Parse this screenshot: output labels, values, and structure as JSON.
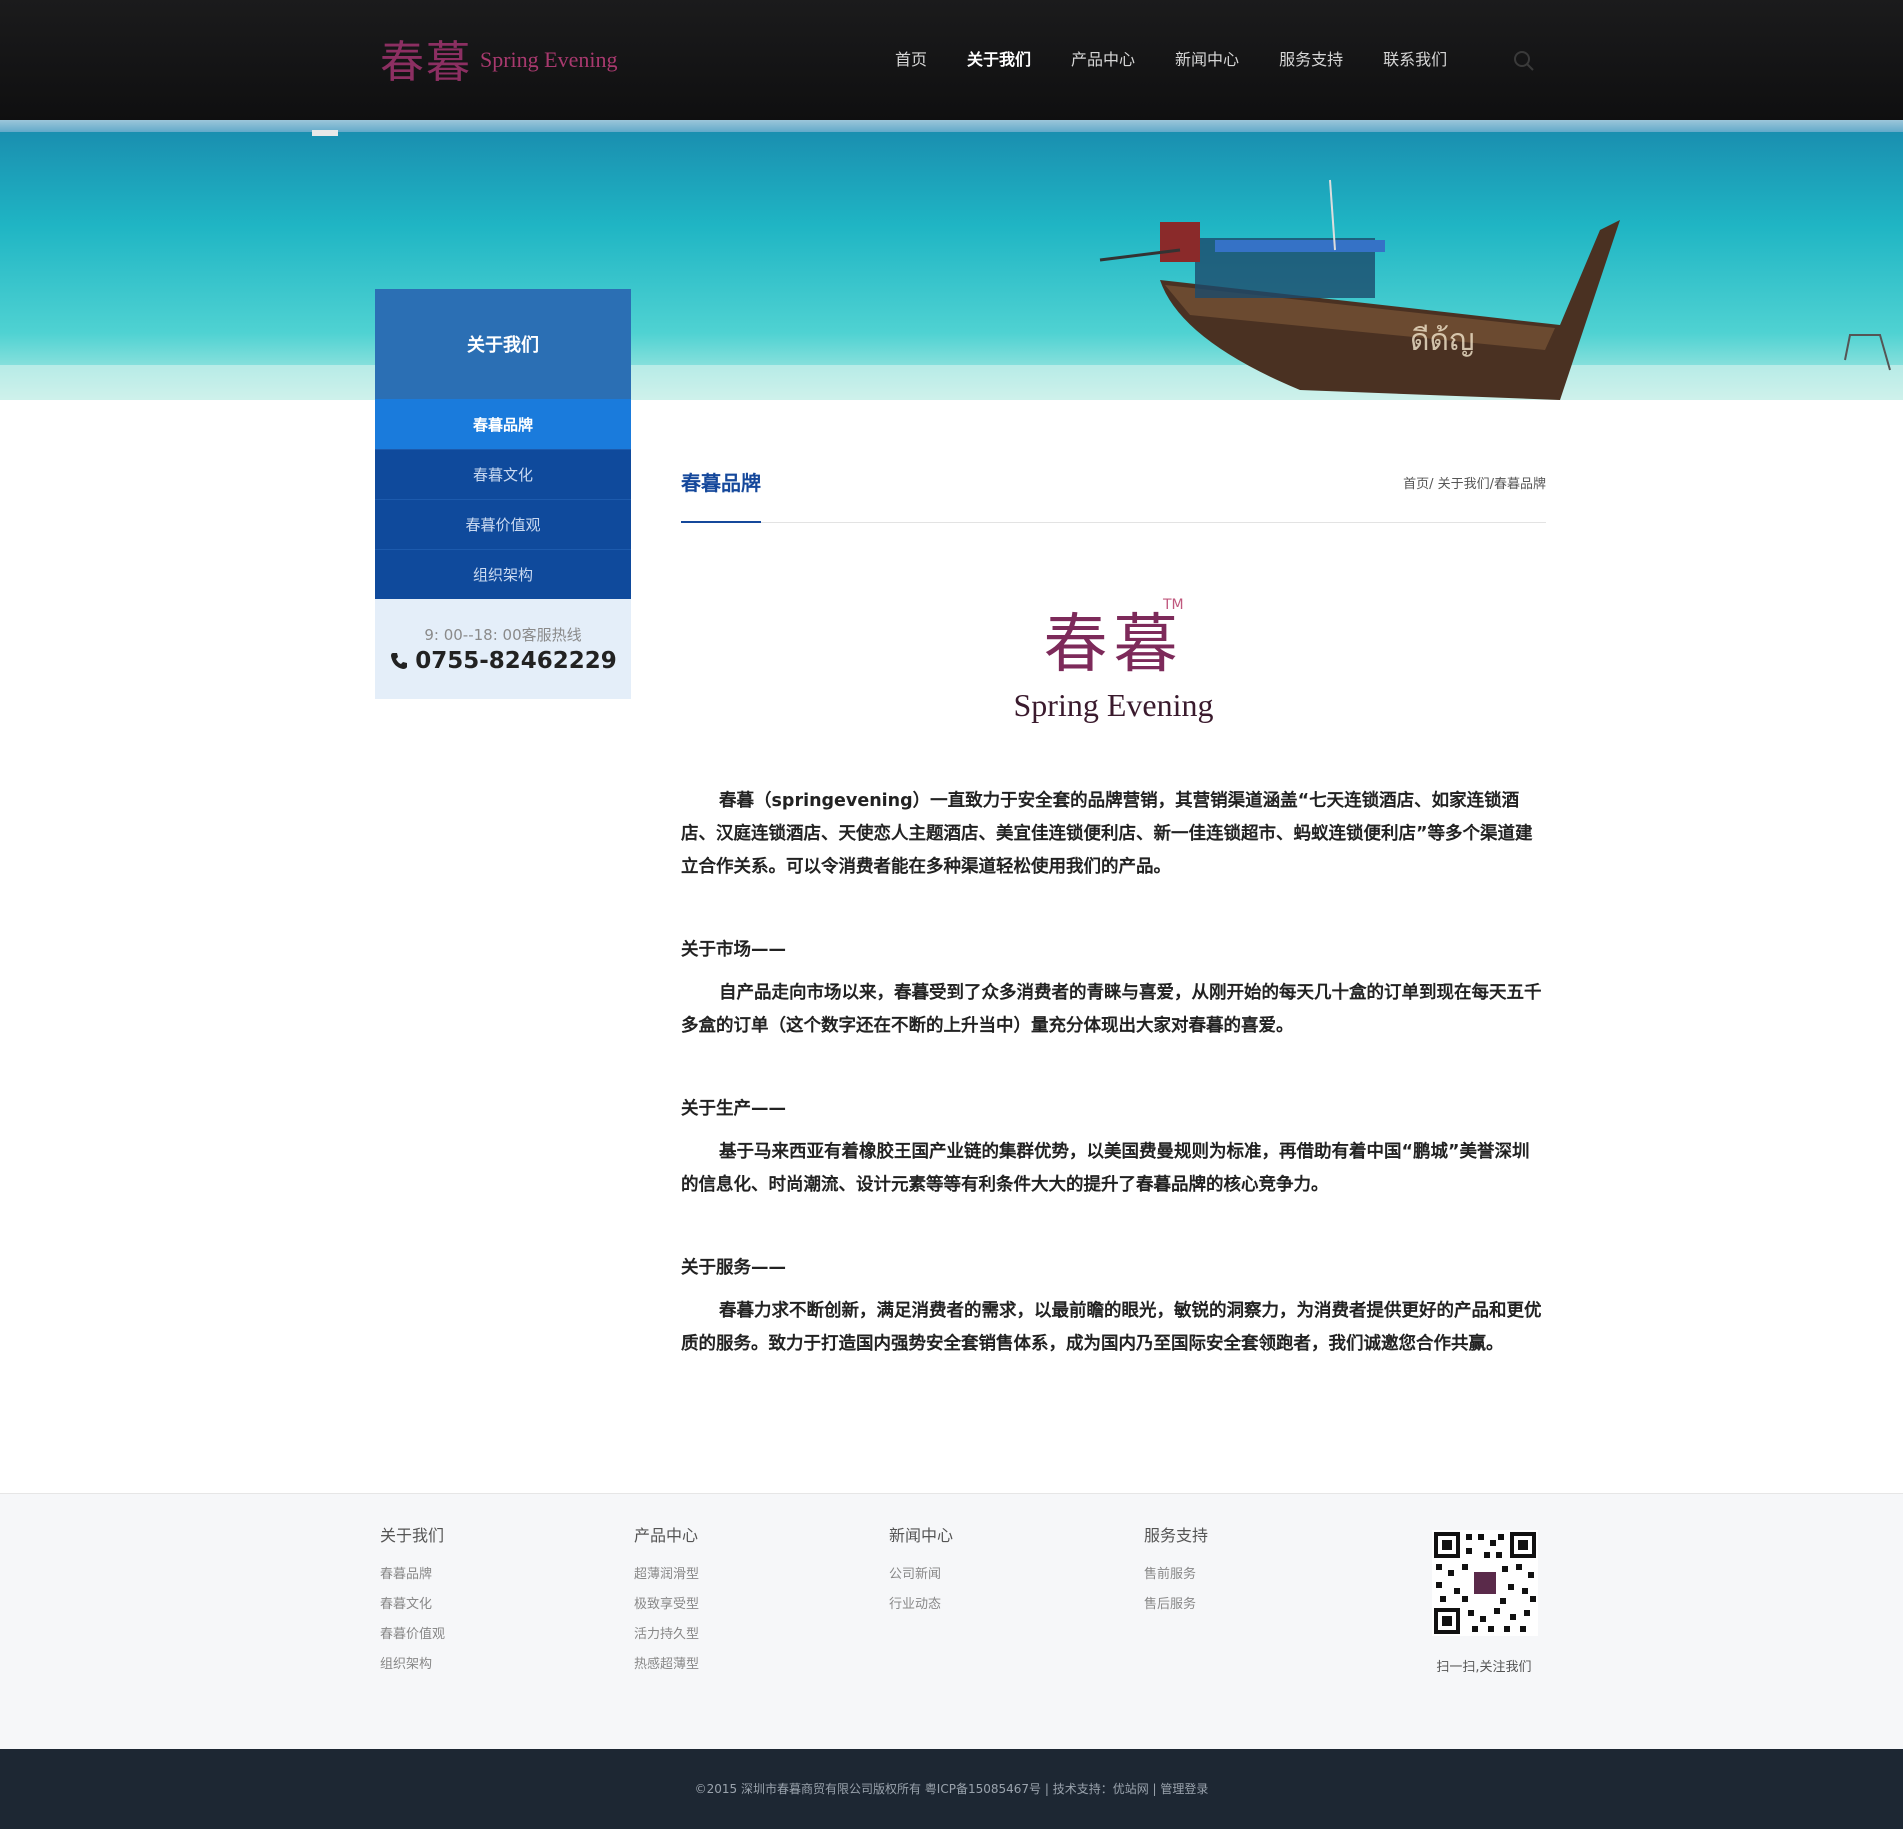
{
  "header": {
    "logo_cn": "春暮",
    "logo_en": "Spring Evening",
    "nav": [
      {
        "label": "首页",
        "active": false
      },
      {
        "label": "关于我们",
        "active": true
      },
      {
        "label": "产品中心",
        "active": false
      },
      {
        "label": "新闻中心",
        "active": false
      },
      {
        "label": "服务支持",
        "active": false
      },
      {
        "label": "联系我们",
        "active": false
      }
    ]
  },
  "sidebar": {
    "title": "关于我们",
    "items": [
      {
        "label": "春暮品牌",
        "active": true
      },
      {
        "label": "春暮文化",
        "active": false
      },
      {
        "label": "春暮价值观",
        "active": false
      },
      {
        "label": "组织架构",
        "active": false
      }
    ],
    "hotline_label": "9: 00--18: 00客服热线",
    "hotline_phone": "0755-82462229"
  },
  "content": {
    "title": "春暮品牌",
    "breadcrumb": "首页/ 关于我们/春暮品牌",
    "brand_cn": "春暮",
    "brand_tm": "TM",
    "brand_en": "Spring Evening",
    "intro": "春暮（springevening）一直致力于安全套的品牌营销，其营销渠道涵盖“七天连锁酒店、如家连锁酒店、汉庭连锁酒店、天使恋人主题酒店、美宜佳连锁便利店、新一佳连锁超市、蚂蚁连锁便利店”等多个渠道建立合作关系。可以令消费者能在多种渠道轻松使用我们的产品。",
    "sections": [
      {
        "head": "关于市场——",
        "body": "自产品走向市场以来，春暮受到了众多消费者的青睐与喜爱，从刚开始的每天几十盒的订单到现在每天五千多盒的订单（这个数字还在不断的上升当中）量充分体现出大家对春暮的喜爱。"
      },
      {
        "head": "关于生产——",
        "body": "基于马来西亚有着橡胶王国产业链的集群优势，以美国费曼规则为标准，再借助有着中国“鹏城”美誉深圳的信息化、时尚潮流、设计元素等等有利条件大大的提升了春暮品牌的核心竞争力。"
      },
      {
        "head": "关于服务——",
        "body": "春暮力求不断创新，满足消费者的需求，以最前瞻的眼光，敏锐的洞察力，为消费者提供更好的产品和更优质的服务。致力于打造国内强势安全套销售体系，成为国内乃至国际安全套领跑者，我们诚邀您合作共赢。"
      }
    ]
  },
  "footer": {
    "columns": [
      {
        "title": "关于我们",
        "items": [
          "春暮品牌",
          "春暮文化",
          "春暮价值观",
          "组织架构"
        ]
      },
      {
        "title": "产品中心",
        "items": [
          "超薄润滑型",
          "极致享受型",
          "活力持久型",
          "热感超薄型"
        ]
      },
      {
        "title": "新闻中心",
        "items": [
          "公司新闻",
          "行业动态"
        ]
      },
      {
        "title": "服务支持",
        "items": [
          "售前服务",
          "售后服务"
        ]
      }
    ],
    "qr_caption": "扫一扫,关注我们",
    "copyright": "©2015 深圳市春暮商贸有限公司版权所有 粤ICP备15085467号 | 技术支持：优站网 | 管理登录"
  },
  "icons": {
    "search": "search-icon",
    "phone": "phone-icon"
  },
  "colors": {
    "header_bg": "#141415",
    "brand_blue": "#15489b",
    "sidebar_active": "#1a7bdc",
    "sidebar_bg": "#0f4a9c",
    "brand_magenta": "#8c2f62",
    "footer_bg": "#1d2733"
  }
}
